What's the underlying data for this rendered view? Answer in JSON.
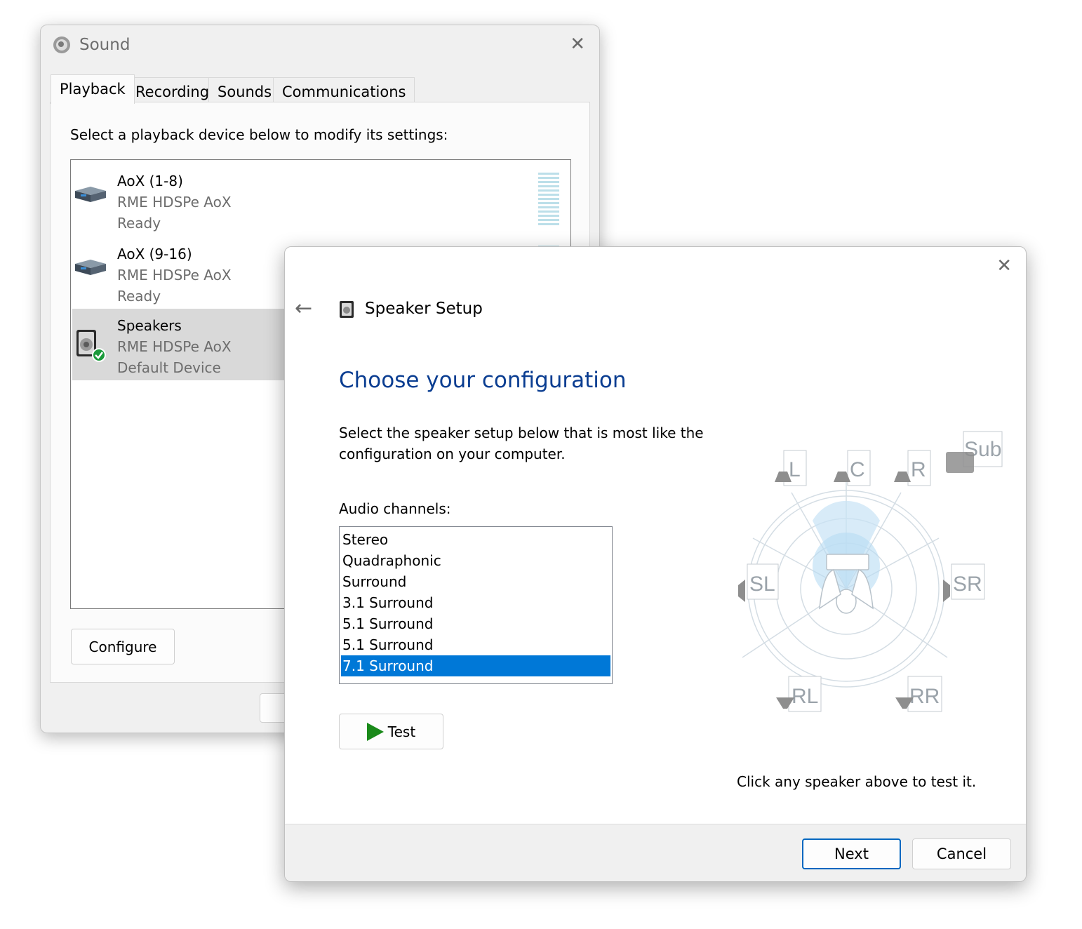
{
  "sound": {
    "title": "Sound",
    "tabs": [
      "Playback",
      "Recording",
      "Sounds",
      "Communications"
    ],
    "instruction": "Select a playback device below to modify its settings:",
    "devices": [
      {
        "name": "AoX (1-8)",
        "driver": "RME HDSPe AoX",
        "status": "Ready"
      },
      {
        "name": "AoX (9-16)",
        "driver": "RME HDSPe AoX",
        "status": "Ready"
      },
      {
        "name": "Speakers",
        "driver": "RME HDSPe AoX",
        "status": "Default Device"
      }
    ],
    "configure_label": "Configure"
  },
  "setup": {
    "title": "Speaker Setup",
    "heading": "Choose your configuration",
    "description": "Select the speaker setup below that is most like the configuration on your computer.",
    "channels_label": "Audio channels:",
    "channels": [
      "Stereo",
      "Quadraphonic",
      "Surround",
      "3.1 Surround",
      "5.1 Surround",
      "5.1 Surround",
      "7.1 Surround"
    ],
    "selected_channel": "7.1 Surround",
    "test_label": "Test",
    "hint": "Click any speaker above to test it.",
    "next_label": "Next",
    "cancel_label": "Cancel",
    "speakers": [
      "L",
      "C",
      "R",
      "Sub",
      "SL",
      "SR",
      "RL",
      "RR"
    ]
  },
  "colors": {
    "accent": "#0078d7",
    "heading": "#0a3d91",
    "play": "#1a8a1a",
    "default_check": "#1a9a3a"
  }
}
